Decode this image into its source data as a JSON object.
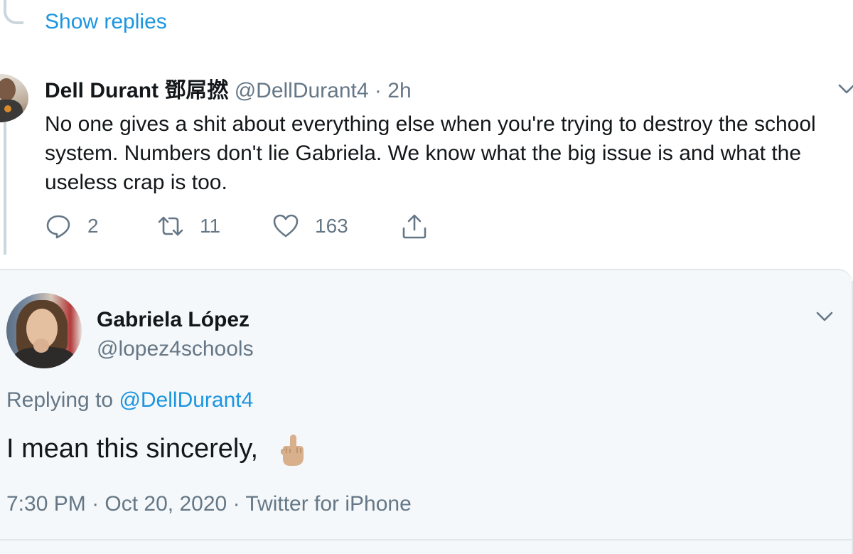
{
  "thread": {
    "show_replies_label": "Show replies"
  },
  "reply_tweet": {
    "author_name": "Dell Durant 鄧屌撚",
    "author_handle": "@DellDurant4",
    "separator": "·",
    "time": "2h",
    "text": "No one gives a shit about everything else when you're trying to destroy the school system. Numbers don't lie Gabriela. We know what the big issue is and what the useless crap is too.",
    "actions": {
      "reply_count": "2",
      "retweet_count": "11",
      "like_count": "163"
    }
  },
  "focused_tweet": {
    "author_name": "Gabriela López",
    "author_handle": "@lopez4schools",
    "replying_prefix": "Replying to",
    "replying_to": "@DellDurant4",
    "text": "I mean this sincerely,",
    "time": "7:30 PM",
    "date": "Oct 20, 2020",
    "separator_1": "·",
    "separator_2": "·",
    "source": "Twitter for iPhone"
  },
  "icons": {
    "reply": "reply-icon",
    "retweet": "retweet-icon",
    "like": "heart-icon",
    "share": "share-icon",
    "more": "chevron-down-icon",
    "emoji": "middle-finger-emoji"
  },
  "colors": {
    "link": "#1b95e0",
    "secondary_text": "#657786",
    "primary_text": "#14171a",
    "thread_line": "#ccd6dd",
    "card_background": "#f5f8fa"
  }
}
